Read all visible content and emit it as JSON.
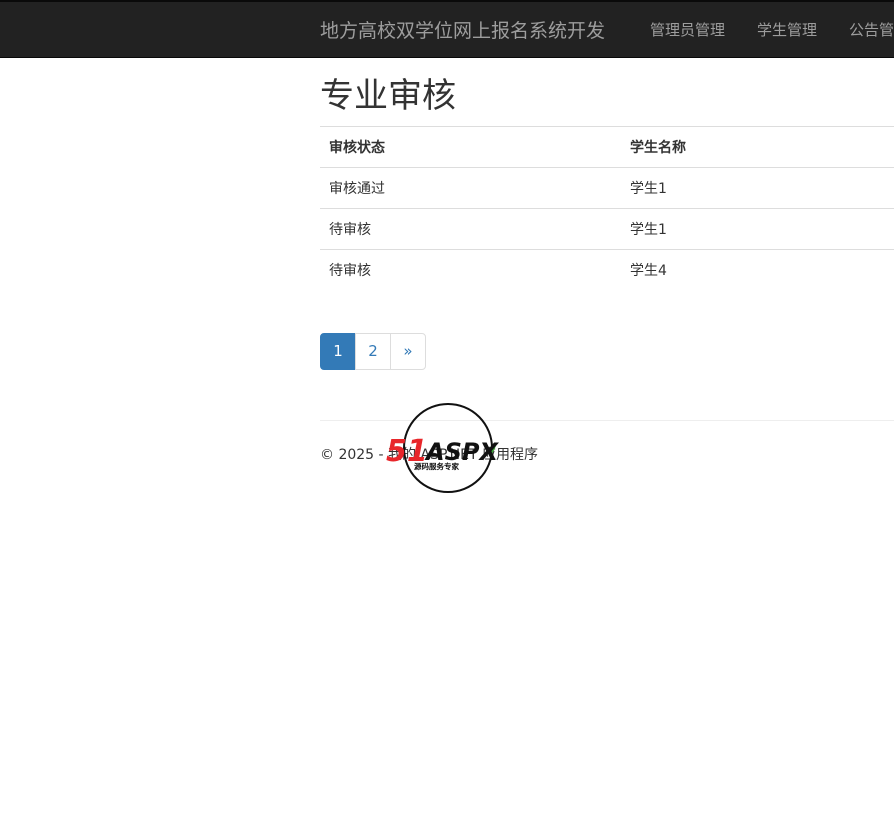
{
  "navbar": {
    "brand": "地方高校双学位网上报名系统开发",
    "items": [
      "管理员管理",
      "学生管理",
      "公告管理"
    ]
  },
  "page": {
    "title": "专业审核"
  },
  "table": {
    "headers": [
      "审核状态",
      "学生名称"
    ],
    "rows": [
      [
        "审核通过",
        "学生1"
      ],
      [
        "待审核",
        "学生1"
      ],
      [
        "待审核",
        "学生4"
      ]
    ]
  },
  "pagination": {
    "pages": [
      "1",
      "2",
      "»"
    ],
    "active": "1"
  },
  "footer": {
    "text": "© 2025 - 我的 ASP.NET 应用程序"
  },
  "watermark": {
    "brand": "51ASPX",
    "tagline": "源码服务专家",
    "colors": {
      "red": "#e8262a",
      "green": "#3aa935",
      "black": "#111111"
    }
  }
}
